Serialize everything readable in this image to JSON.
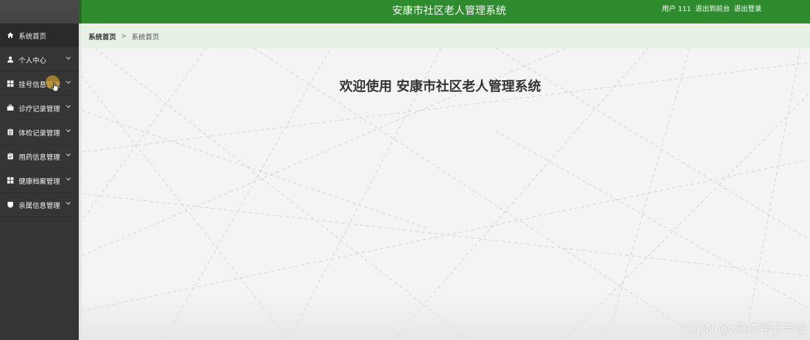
{
  "header": {
    "title": "安康市社区老人管理系统",
    "user_label": "用户 111",
    "back_to_front": "退出到前台",
    "logout": "退出登录"
  },
  "breadcrumb": {
    "home": "系统首页",
    "separator": ">",
    "current": "系统首页"
  },
  "sidebar": {
    "items": [
      {
        "label": "系统首页",
        "icon": "home-icon",
        "has_children": false
      },
      {
        "label": "个人中心",
        "icon": "user-icon",
        "has_children": true
      },
      {
        "label": "挂号信息管理",
        "icon": "grid-icon",
        "has_children": true
      },
      {
        "label": "诊疗记录管理",
        "icon": "briefcase-icon",
        "has_children": true
      },
      {
        "label": "体检记录管理",
        "icon": "clipboard-icon",
        "has_children": true
      },
      {
        "label": "用药信息管理",
        "icon": "clipboard-check-icon",
        "has_children": true
      },
      {
        "label": "健康档案管理",
        "icon": "grid-icon",
        "has_children": true
      },
      {
        "label": "亲属信息管理",
        "icon": "card-icon",
        "has_children": true
      }
    ]
  },
  "main": {
    "welcome": "欢迎使用 安康市社区老人管理系统"
  },
  "watermark": "CSDN @x陈杰学长毕设",
  "colors": {
    "header_green": "#2e8b2e",
    "sidebar_bg": "#353535",
    "breadcrumb_bg": "#e8f1e6",
    "main_bg": "#f4f4f4"
  }
}
